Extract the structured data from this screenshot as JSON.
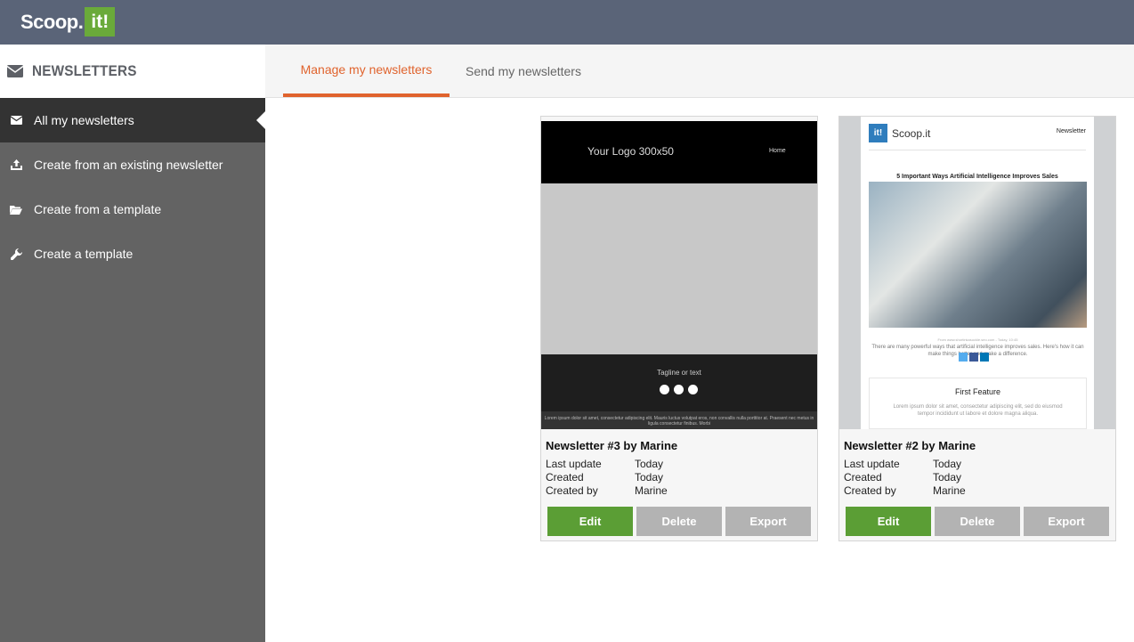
{
  "app": {
    "logo_word": "Scoop.",
    "logo_badge": "it!"
  },
  "sidebar": {
    "title": "NEWSLETTERS",
    "items": [
      {
        "label": "All my newsletters",
        "icon": "envelope-icon",
        "active": true
      },
      {
        "label": "Create from an existing newsletter",
        "icon": "upload-icon"
      },
      {
        "label": "Create from a template",
        "icon": "folder-open-icon"
      },
      {
        "label": "Create a template",
        "icon": "wrench-icon"
      }
    ]
  },
  "tabs": [
    {
      "label": "Manage my newsletters",
      "active": true
    },
    {
      "label": "Send my newsletters"
    }
  ],
  "meta_labels": {
    "last_update": "Last update",
    "created": "Created",
    "created_by": "Created by"
  },
  "buttons": {
    "edit": "Edit",
    "delete": "Delete",
    "export": "Export"
  },
  "colors": {
    "topbar": "#5a6478",
    "accent": "#e0632d",
    "edit_green": "#5b9e35",
    "sidebar": "#636363"
  },
  "newsletters": [
    {
      "name": "Newsletter #3 by Marine",
      "last_update": "Today",
      "created": "Today",
      "created_by": "Marine",
      "preview": {
        "logo_text": "Your Logo 300x50",
        "home_link": "Home",
        "tagline": "Tagline or text",
        "footer_text": "Lorem ipsum dolor sit amet, consectetur adipiscing elit. Mauris luctus volutpat eros, non convallis nulla porttitor at. Praesent nec metus in ligula consectetur finibus. Morbi"
      }
    },
    {
      "name": "Newsletter #2 by Marine",
      "last_update": "Today",
      "created": "Today",
      "created_by": "Marine",
      "preview": {
        "logo_badge": "it!",
        "logo_word": "Scoop.it",
        "label": "Newsletter",
        "headline": "5 Important Ways Artificial Intelligence Improves Sales",
        "source": "From www.shortinkasuckle.seo.com - Today, 10:45",
        "caption": "There are many powerful ways that artificial intelligence improves sales. Here's how it can make things better and make a difference.",
        "feature_title": "First Feature",
        "feature_text": "Lorem ipsum dolor sit amet, consectetur adipiscing elit, sed do eiusmod tempor incididunt ut labore et dolore magna aliqua."
      }
    }
  ]
}
